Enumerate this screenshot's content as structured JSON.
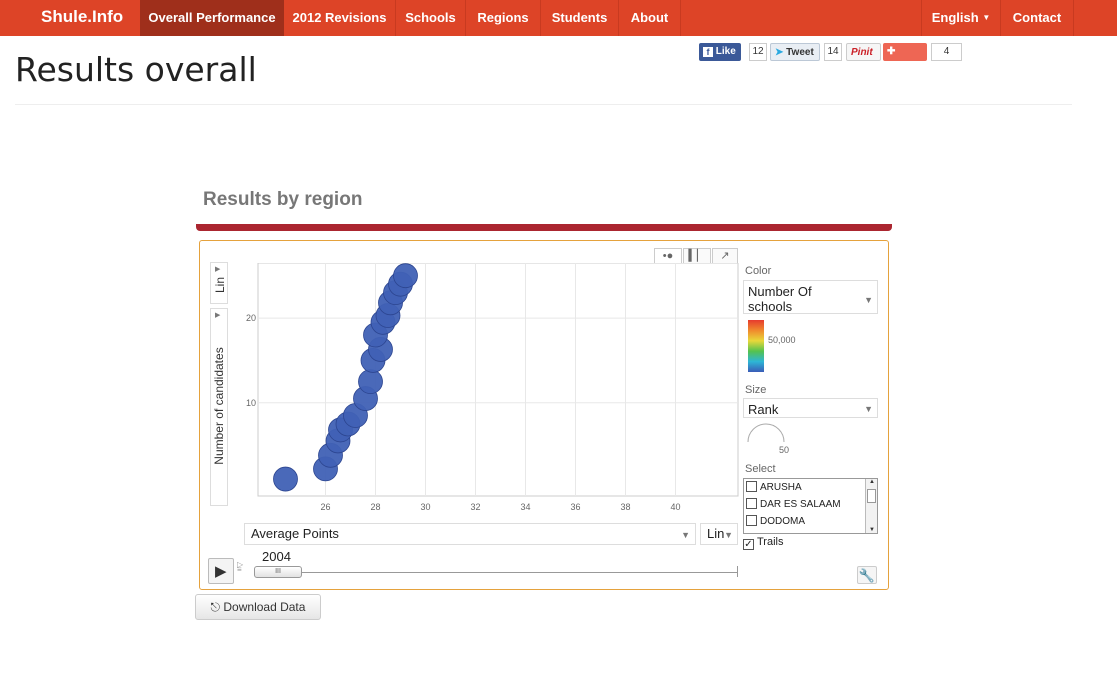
{
  "brand": "Shule.Info",
  "nav": {
    "items": [
      "Overall Performance",
      "2012 Revisions",
      "Schools",
      "Regions",
      "Students",
      "About"
    ],
    "language": "English",
    "contact": "Contact"
  },
  "social": {
    "like_label": "Like",
    "like_count": "12",
    "tweet_label": "Tweet",
    "tweet_count": "14",
    "pin_label": "Pinit",
    "share_label": "Share",
    "share_count": "4"
  },
  "page_title": "Results overall",
  "section_title": "Results by region",
  "controls": {
    "y_scale": "Lin",
    "x_scale": "Lin",
    "x_axis_select": "Average Points",
    "color_label": "Color",
    "color_value": "Number Of schools",
    "color_legend_value": "50,000",
    "size_label": "Size",
    "size_value": "Rank",
    "size_legend_value": "50",
    "select_label": "Select",
    "regions": [
      "ARUSHA",
      "DAR ES SALAAM",
      "DODOMA"
    ],
    "trails_label": "Trails",
    "trails_checked": true,
    "year": "2004"
  },
  "download_label": "Download Data",
  "colors": {
    "nav": "#dd4427",
    "nav_active": "#9f2f1b",
    "accent_bar": "#ab2630",
    "bubble": "#4061b5"
  },
  "chart_data": {
    "type": "scatter",
    "xlabel": "",
    "ylabel": "Number of candidates",
    "xlim": [
      23.3,
      42.5
    ],
    "ylim": [
      -1,
      26.5
    ],
    "x_ticks": [
      26,
      28,
      30,
      32,
      34,
      36,
      38,
      40
    ],
    "y_ticks": [
      10,
      20
    ],
    "grid": true,
    "series": [
      {
        "x": [
          24.4,
          26.0,
          26.2,
          26.5,
          26.6,
          26.9,
          27.2,
          27.6,
          27.8,
          27.9,
          28.2,
          28.0,
          28.3,
          28.5,
          28.6,
          28.8,
          29.0,
          29.2
        ],
        "y": [
          1.0,
          2.2,
          3.8,
          5.5,
          6.8,
          7.5,
          8.5,
          10.5,
          12.5,
          15.0,
          16.3,
          18.0,
          19.5,
          20.3,
          21.8,
          23.0,
          24.0,
          25.0
        ]
      }
    ]
  }
}
